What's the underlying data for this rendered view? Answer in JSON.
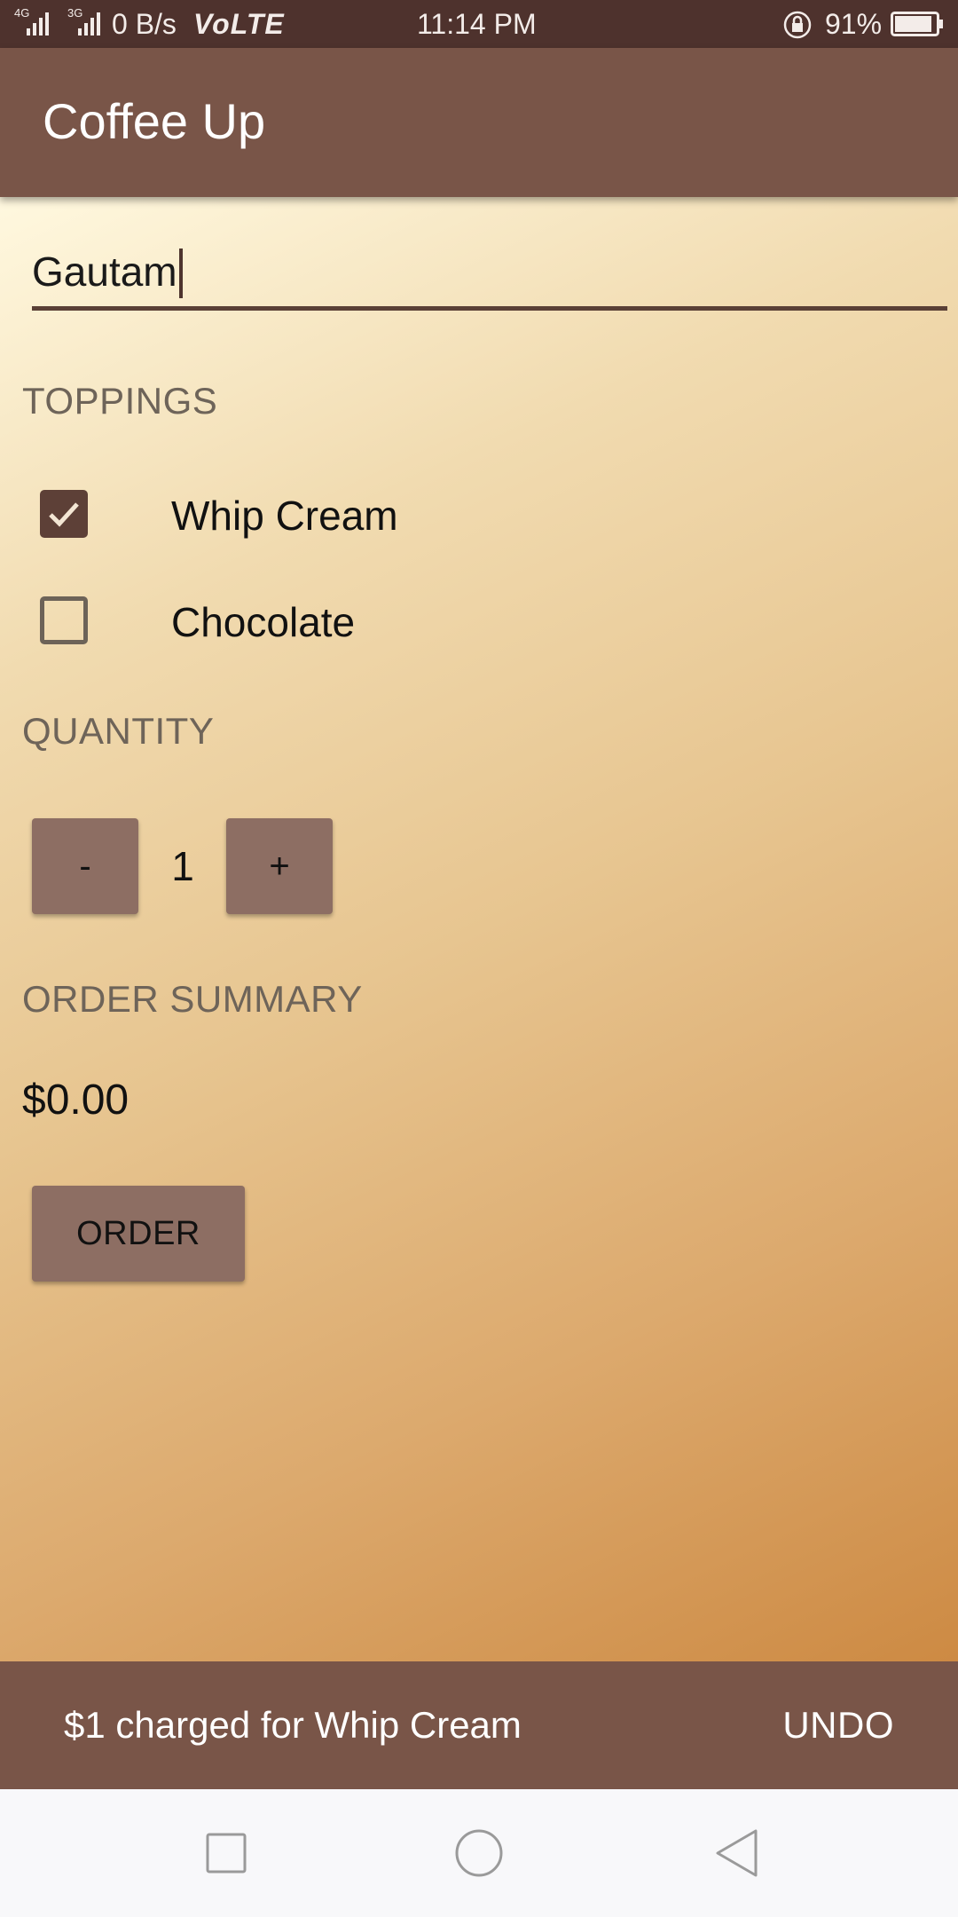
{
  "status_bar": {
    "network_4g": "4G",
    "network_3g": "3G",
    "speed": "0 B/s",
    "volte": "VoLTE",
    "time": "11:14 PM",
    "battery": "91%",
    "battery_level": 0.91
  },
  "app_bar": {
    "title": "Coffee Up"
  },
  "form": {
    "name_value": "Gautam",
    "toppings_label": "TOPPINGS",
    "toppings": [
      {
        "label": "Whip Cream",
        "checked": true
      },
      {
        "label": "Chocolate",
        "checked": false
      }
    ],
    "quantity_label": "QUANTITY",
    "decrement_label": "-",
    "quantity": "1",
    "increment_label": "+",
    "order_summary_label": "ORDER SUMMARY",
    "price": "$0.00",
    "order_button": "ORDER"
  },
  "snackbar": {
    "message": "$1 charged for Whip Cream",
    "action": "UNDO"
  },
  "nav_bar": {
    "recent_icon": "square-icon",
    "home_icon": "circle-icon",
    "back_icon": "triangle-back-icon"
  },
  "colors": {
    "status_bar": "#4e322d",
    "primary": "#795548",
    "button": "#8d6e63",
    "checkbox_checked": "#5d4037"
  }
}
